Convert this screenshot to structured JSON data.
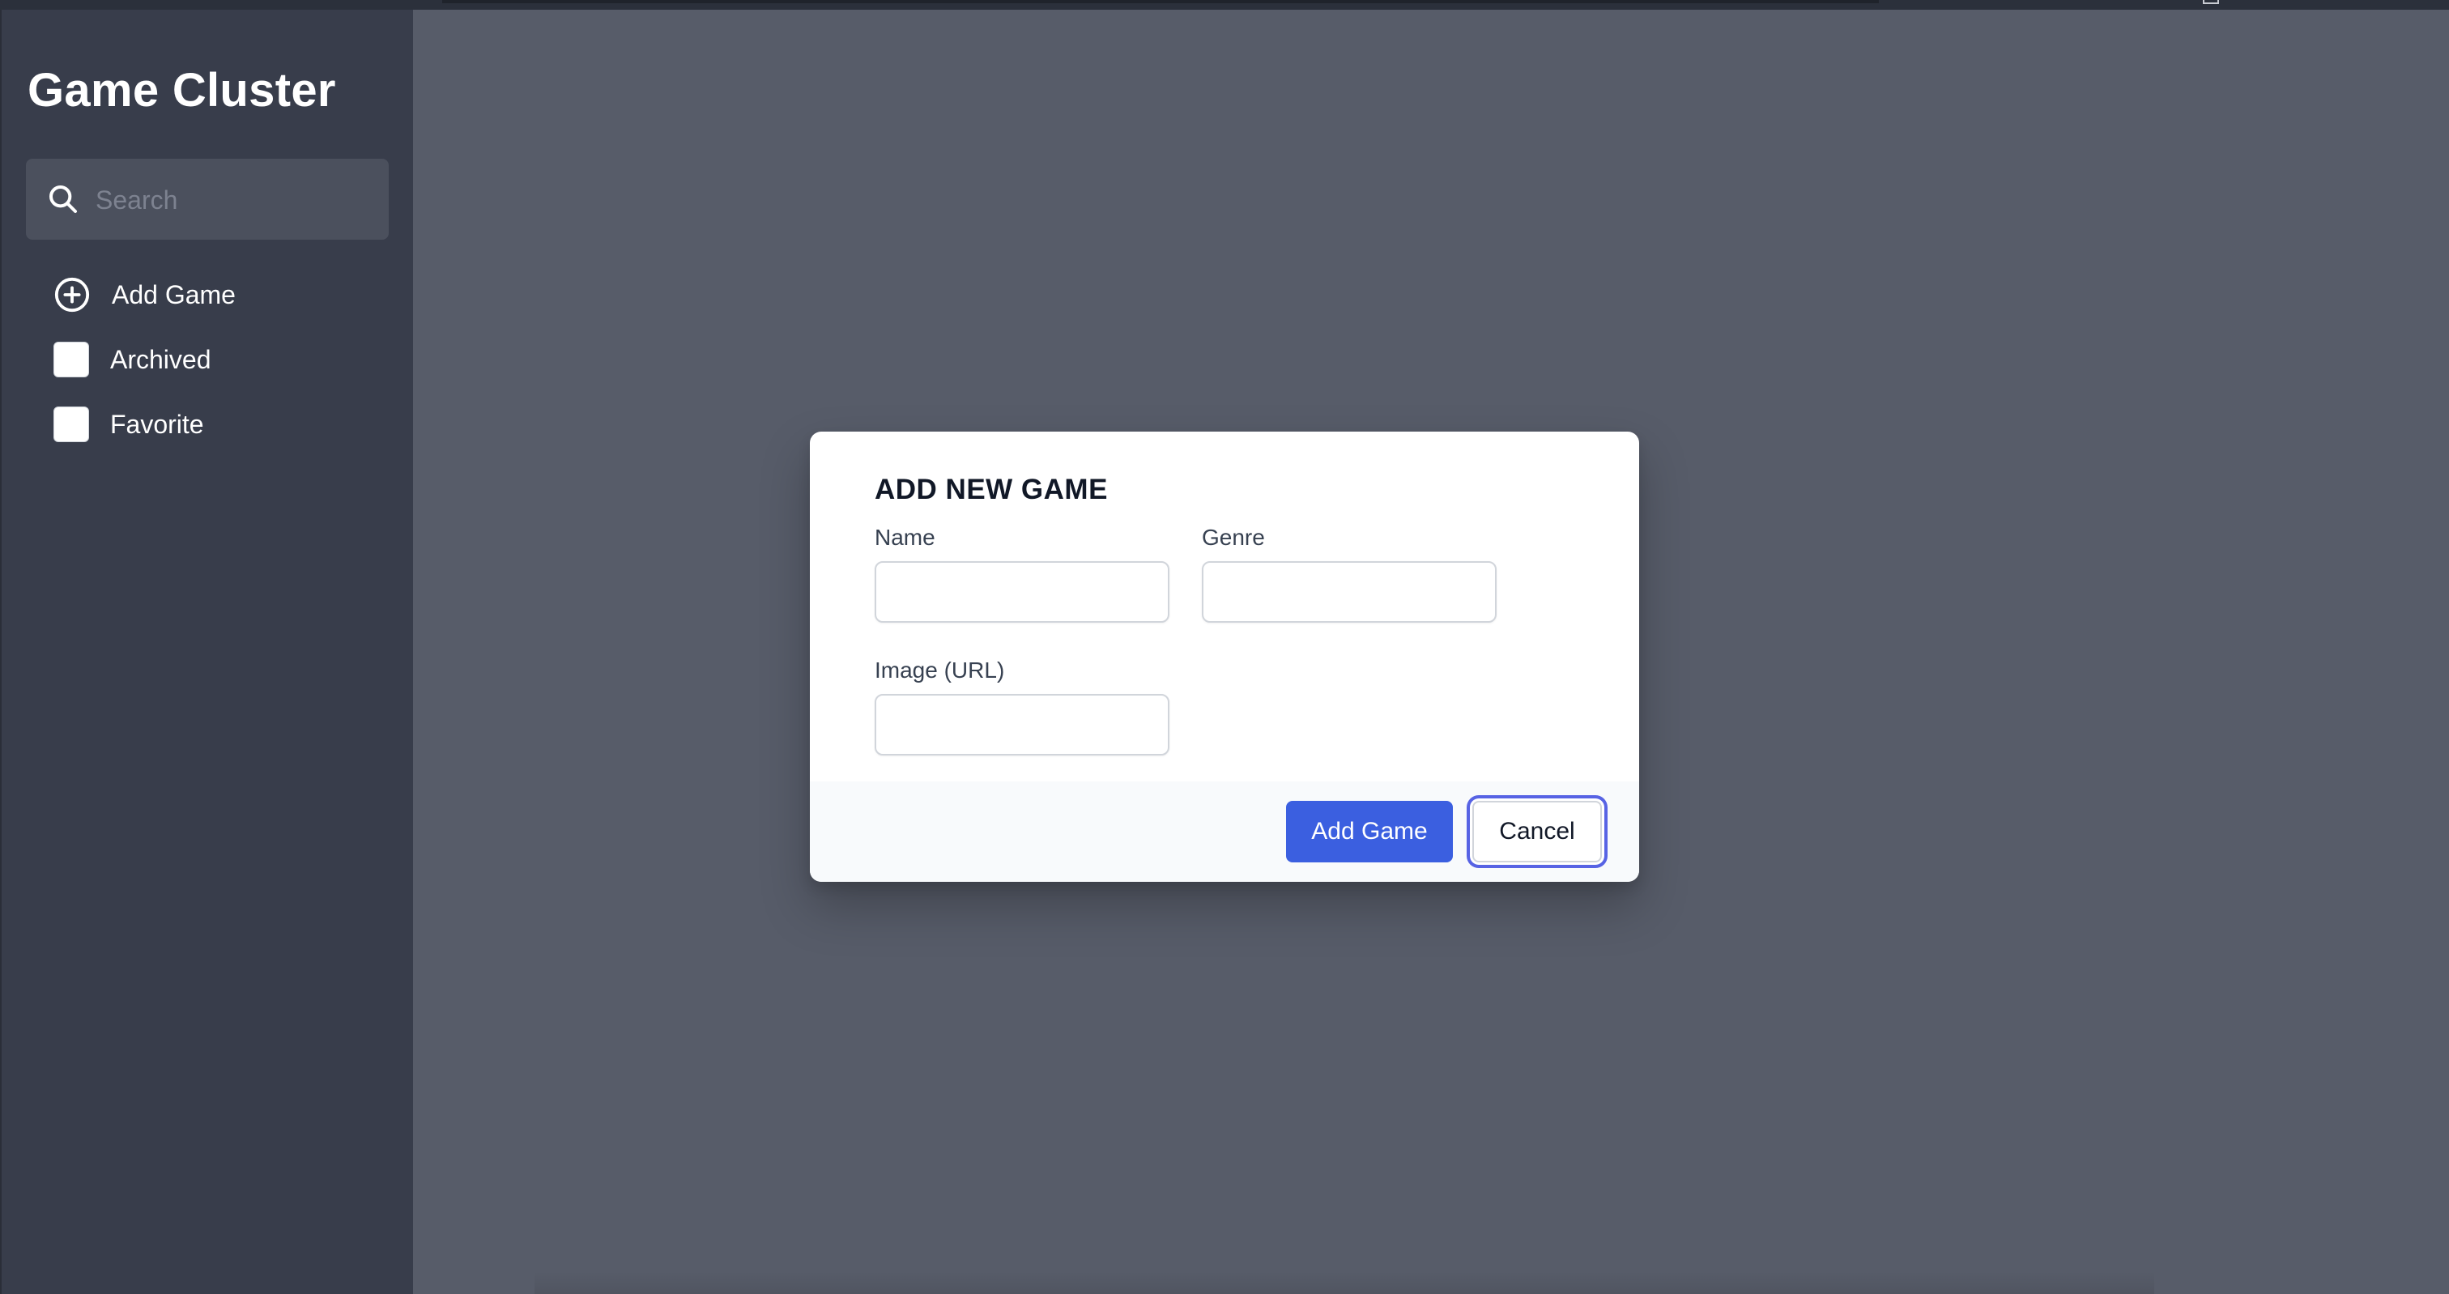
{
  "sidebar": {
    "app_title": "Game Cluster",
    "search": {
      "placeholder": "Search",
      "value": ""
    },
    "items": [
      {
        "label": "Add Game",
        "icon": "plus-circle-icon"
      },
      {
        "label": "Archived",
        "icon": "checkbox",
        "checked": false
      },
      {
        "label": "Favorite",
        "icon": "checkbox",
        "checked": false
      }
    ]
  },
  "modal": {
    "title": "ADD NEW GAME",
    "fields": {
      "name": {
        "label": "Name",
        "value": ""
      },
      "genre": {
        "label": "Genre",
        "value": ""
      },
      "image_url": {
        "label": "Image (URL)",
        "value": ""
      }
    },
    "buttons": {
      "submit_label": "Add Game",
      "cancel_label": "Cancel"
    }
  },
  "colors": {
    "sidebar_bg": "#383d4b",
    "backdrop": "#575c69",
    "primary": "#3b5fe0",
    "focus_ring": "#5763e4"
  }
}
